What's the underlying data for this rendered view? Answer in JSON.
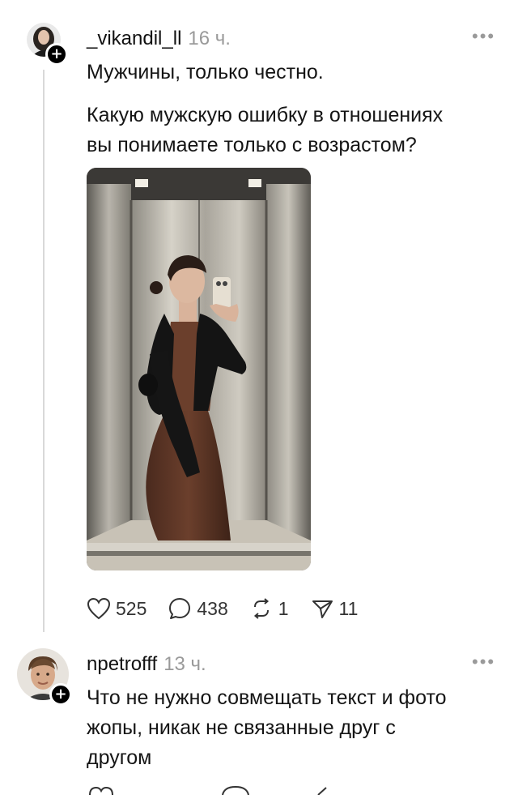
{
  "post": {
    "username": "_vikandil_ll",
    "time": "16 ч.",
    "text_line_1": "Мужчины, только честно.",
    "text_line_2": "Какую мужскую ошибку в отношениях",
    "text_line_3": "вы понимаете только с возрастом?",
    "photo_icon": "elevator-mirror-selfie-photo",
    "actions": {
      "likes": "525",
      "comments": "438",
      "reposts": "1",
      "shares": "11"
    }
  },
  "reply": {
    "username": "npetrofff",
    "time": "13 ч.",
    "text_line_1": "Что не нужно совмещать текст и фото",
    "text_line_2": "жопы, никак не связанные друг с",
    "text_line_3": "другом"
  },
  "icons": {
    "more": "more-horizontal-icon",
    "like": "heart-icon",
    "comment": "comment-bubble-icon",
    "repost": "repost-icon",
    "share": "send-icon",
    "follow": "plus-icon"
  },
  "colors": {
    "text": "#111111",
    "muted": "#9a9a9a",
    "thread_line": "#d9d9d9"
  }
}
